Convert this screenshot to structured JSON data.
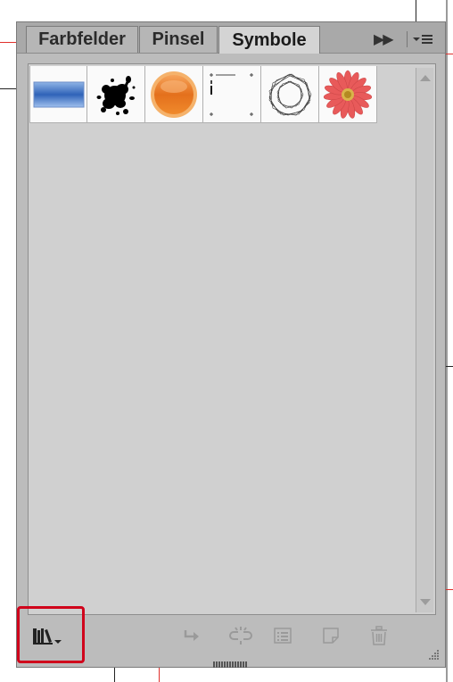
{
  "panel": {
    "tabs": [
      {
        "label": "Farbfelder",
        "active": false
      },
      {
        "label": "Pinsel",
        "active": false
      },
      {
        "label": "Symbole",
        "active": true
      }
    ],
    "controls": {
      "expand_icon": "double-chevron-right-icon",
      "menu_icon": "panel-menu-icon"
    }
  },
  "symbols": [
    {
      "name": "blue-gradient-bar"
    },
    {
      "name": "ink-splatter"
    },
    {
      "name": "orange-glossy-button"
    },
    {
      "name": "ruler-marks"
    },
    {
      "name": "spirograph-ring"
    },
    {
      "name": "pink-daisy-flower"
    }
  ],
  "toolbar": {
    "library_icon": "symbol-libraries-menu-icon",
    "buttons": [
      {
        "icon": "place-symbol-instance-icon"
      },
      {
        "icon": "break-link-icon"
      },
      {
        "icon": "symbol-options-icon"
      },
      {
        "icon": "new-symbol-icon"
      },
      {
        "icon": "delete-symbol-icon"
      }
    ]
  },
  "colors": {
    "accent_highlight": "#d0021b",
    "panel_bg": "#bcbcbc",
    "content_bg": "#d0d0d0"
  }
}
